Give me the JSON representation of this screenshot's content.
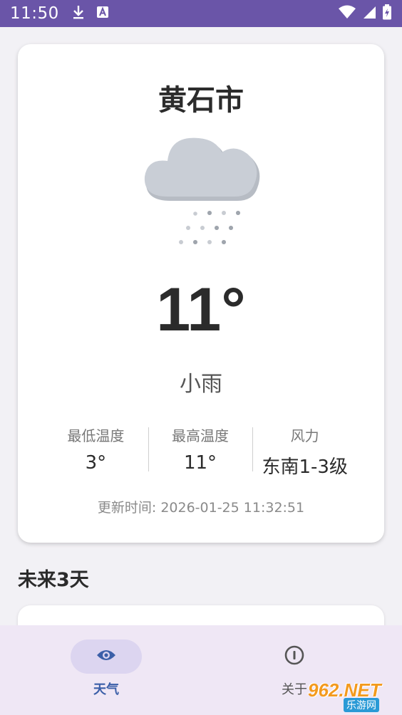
{
  "status_bar": {
    "time": "11:50",
    "icons": [
      "download-icon",
      "translate-icon",
      "wifi-icon",
      "signal-icon",
      "battery-charging-icon"
    ]
  },
  "weather": {
    "city": "黄石市",
    "icon": "cloud-rain-icon",
    "temperature": "11°",
    "description": "小雨",
    "stats": [
      {
        "label": "最低温度",
        "value": "3°"
      },
      {
        "label": "最高温度",
        "value": "11°"
      },
      {
        "label": "风力",
        "value": "东南1-3级"
      }
    ],
    "updated": "更新时间: 2026-01-25 11:32:51"
  },
  "forecast": {
    "title": "未来3天"
  },
  "nav": {
    "weather_label": "天气",
    "weather_icon": "eye-icon",
    "about_label": "关于",
    "about_icon": "info-circle-icon",
    "active_color": "#3b5fa8"
  },
  "watermark": {
    "main": "962.NET",
    "sub": "乐游网"
  }
}
